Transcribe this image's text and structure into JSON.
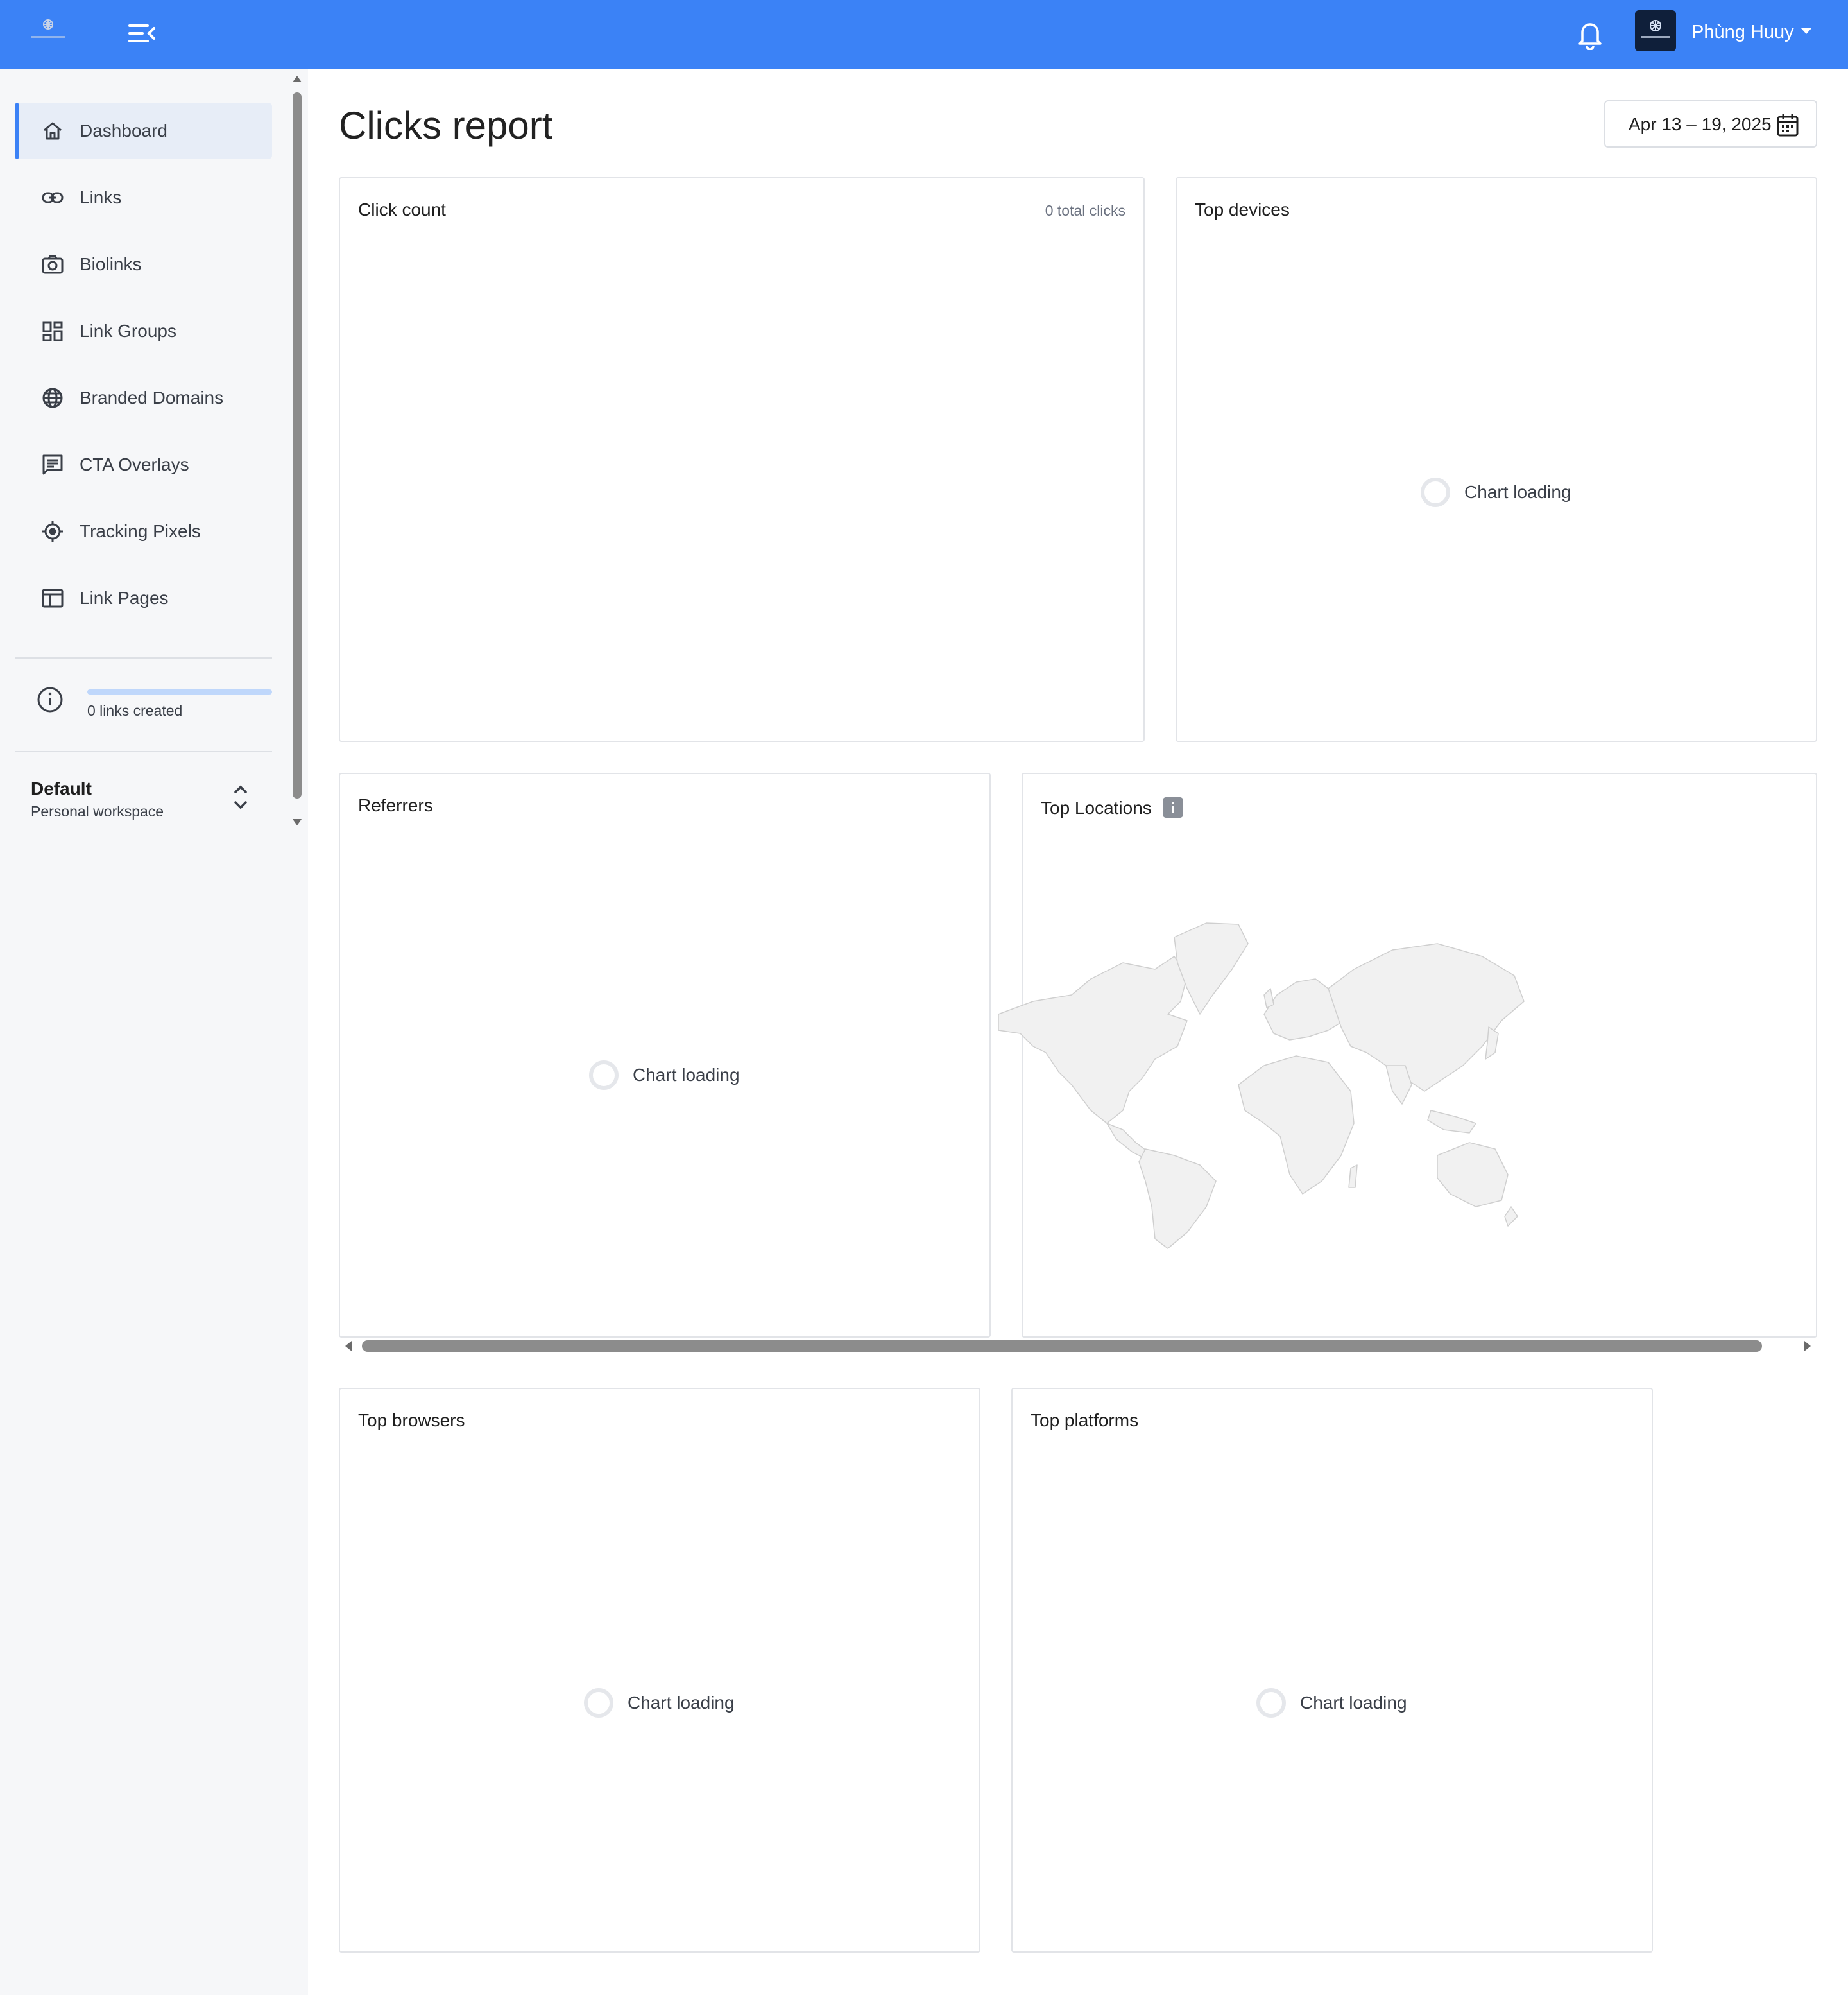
{
  "header": {
    "logo_icon": "brand-logo-icon",
    "menu_icon": "menu-collapse-icon",
    "notification_icon": "bell-icon",
    "user_name": "Phùng Huuy",
    "accent_color": "#3b82f6"
  },
  "sidebar": {
    "items": [
      {
        "label": "Dashboard",
        "icon": "home-icon",
        "active": true
      },
      {
        "label": "Links",
        "icon": "link-icon"
      },
      {
        "label": "Biolinks",
        "icon": "camera-icon"
      },
      {
        "label": "Link Groups",
        "icon": "grid-icon"
      },
      {
        "label": "Branded Domains",
        "icon": "globe-icon"
      },
      {
        "label": "CTA Overlays",
        "icon": "message-icon"
      },
      {
        "label": "Tracking Pixels",
        "icon": "target-icon"
      },
      {
        "label": "Link Pages",
        "icon": "page-icon"
      }
    ],
    "usage": {
      "text": "0 links created",
      "progress": 0
    },
    "workspace": {
      "name": "Default",
      "subtitle": "Personal workspace"
    }
  },
  "main": {
    "title": "Clicks report",
    "date_range": "Apr 13 – 19, 2025",
    "cards": {
      "click_count": {
        "title": "Click count",
        "meta": "0 total clicks"
      },
      "top_devices": {
        "title": "Top devices",
        "loading": "Chart loading"
      },
      "referrers": {
        "title": "Referrers",
        "loading": "Chart loading"
      },
      "top_locations": {
        "title": "Top Locations",
        "info_icon": "info-icon"
      },
      "top_browsers": {
        "title": "Top browsers",
        "loading": "Chart loading"
      },
      "top_platforms": {
        "title": "Top platforms",
        "loading": "Chart loading"
      }
    }
  }
}
